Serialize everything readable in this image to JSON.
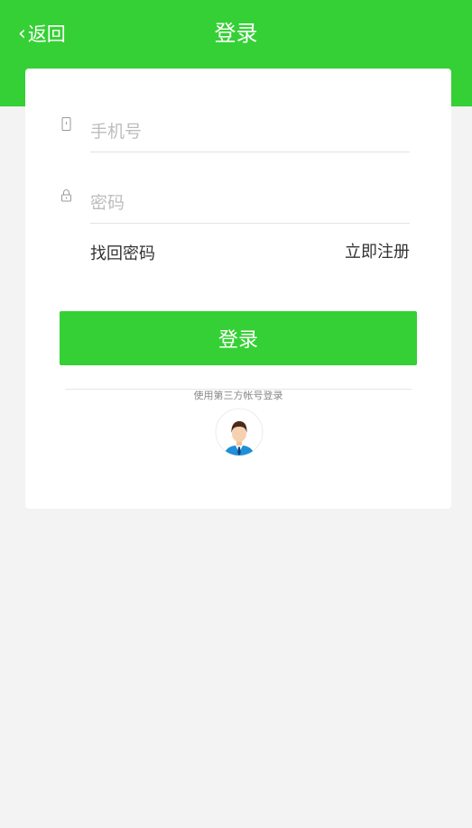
{
  "header": {
    "back_label": "返回",
    "title": "登录"
  },
  "form": {
    "phone_placeholder": "手机号",
    "phone_value": "",
    "password_placeholder": "密码",
    "password_value": "",
    "forgot_label": "找回密码",
    "register_label": "立即注册",
    "submit_label": "登录"
  },
  "third_party": {
    "label": "使用第三方帐号登录",
    "avatar_icon": "user-avatar-icon"
  },
  "icons": {
    "back": "chevron-left-icon",
    "phone": "phone-icon",
    "password": "lock-icon"
  },
  "colors": {
    "accent": "#35d035",
    "page_bg": "#f3f3f3",
    "card_bg": "#ffffff"
  }
}
